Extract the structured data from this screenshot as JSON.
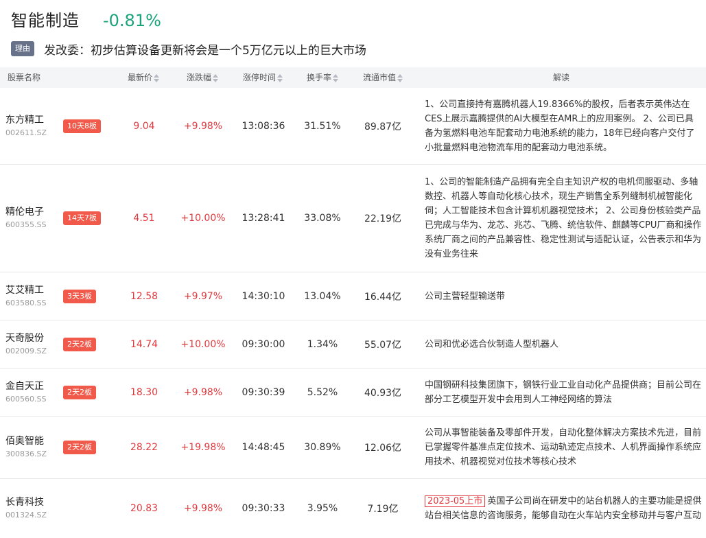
{
  "header": {
    "title": "智能制造",
    "change": "-0.81%"
  },
  "reason": {
    "tag": "理由",
    "text": "发改委：初步估算设备更新将会是一个5万亿元以上的巨大市场"
  },
  "columns": {
    "name": "股票名称",
    "price": "最新价",
    "pct": "涨跌幅",
    "time": "涨停时间",
    "turnover": "换手率",
    "cap": "流通市值",
    "desc": "解读"
  },
  "rows": [
    {
      "name": "东方精工",
      "code": "002611.SZ",
      "badge": "10天8板",
      "price": "9.04",
      "pct": "+9.98%",
      "time": "13:08:36",
      "turnover": "31.51%",
      "cap": "89.87亿",
      "ipo": "",
      "desc": "1、公司直接持有嘉腾机器人19.8366%的股权，后者表示英伟达在CES上展示嘉腾提供的AI大模型在AMR上的应用案例。 2、公司已具备为氢燃料电池车配套动力电池系统的能力，18年已经向客户交付了小批量燃料电池物流车用的配套动力电池系统。"
    },
    {
      "name": "精伦电子",
      "code": "600355.SS",
      "badge": "14天7板",
      "price": "4.51",
      "pct": "+10.00%",
      "time": "13:28:41",
      "turnover": "33.08%",
      "cap": "22.19亿",
      "ipo": "",
      "desc": "1、公司的智能制造产品拥有完全自主知识产权的电机伺服驱动、多轴数控、机器人等自动化核心技术，现生产销售全系列缝制机械智能化伺；人工智能技术包含计算机机器视觉技术； 2、公司身份核验类产品已完成与华为、龙芯、兆芯、飞腾、统信软件、麒麟等CPU厂商和操作系统厂商之间的产品兼容性、稳定性测试与适配认证，公告表示和华为没有业务往来"
    },
    {
      "name": "艾艾精工",
      "code": "603580.SS",
      "badge": "3天3板",
      "price": "12.58",
      "pct": "+9.97%",
      "time": "14:30:10",
      "turnover": "13.04%",
      "cap": "16.44亿",
      "ipo": "",
      "desc": "公司主营轻型输送带"
    },
    {
      "name": "天奇股份",
      "code": "002009.SZ",
      "badge": "2天2板",
      "price": "14.74",
      "pct": "+10.00%",
      "time": "09:30:00",
      "turnover": "1.34%",
      "cap": "55.07亿",
      "ipo": "",
      "desc": "公司和优必选合伙制造人型机器人"
    },
    {
      "name": "金自天正",
      "code": "600560.SS",
      "badge": "2天2板",
      "price": "18.30",
      "pct": "+9.98%",
      "time": "09:30:39",
      "turnover": "5.52%",
      "cap": "40.93亿",
      "ipo": "",
      "desc": "中国钢研科技集团旗下，钢铁行业工业自动化产品提供商；目前公司在部分工艺模型开发中会用到人工神经网络的算法"
    },
    {
      "name": "佰奥智能",
      "code": "300836.SZ",
      "badge": "2天2板",
      "price": "28.22",
      "pct": "+19.98%",
      "time": "14:48:45",
      "turnover": "30.89%",
      "cap": "12.06亿",
      "ipo": "",
      "desc": "公司从事智能装备及零部件开发，自动化整体解决方案技术先进，目前已掌握零件基准点定位技术、运动轨迹定点技术、人机界面操作系统应用技术、机器视觉对位技术等核心技术"
    },
    {
      "name": "长青科技",
      "code": "001324.SZ",
      "badge": "",
      "price": "20.83",
      "pct": "+9.98%",
      "time": "09:30:33",
      "turnover": "3.95%",
      "cap": "7.19亿",
      "ipo": "2023-05上市",
      "desc": "英国子公司尚在研发中的站台机器人的主要功能是提供站台相关信息的咨询服务，能够自动在火车站内安全移动并与客户互动"
    }
  ]
}
